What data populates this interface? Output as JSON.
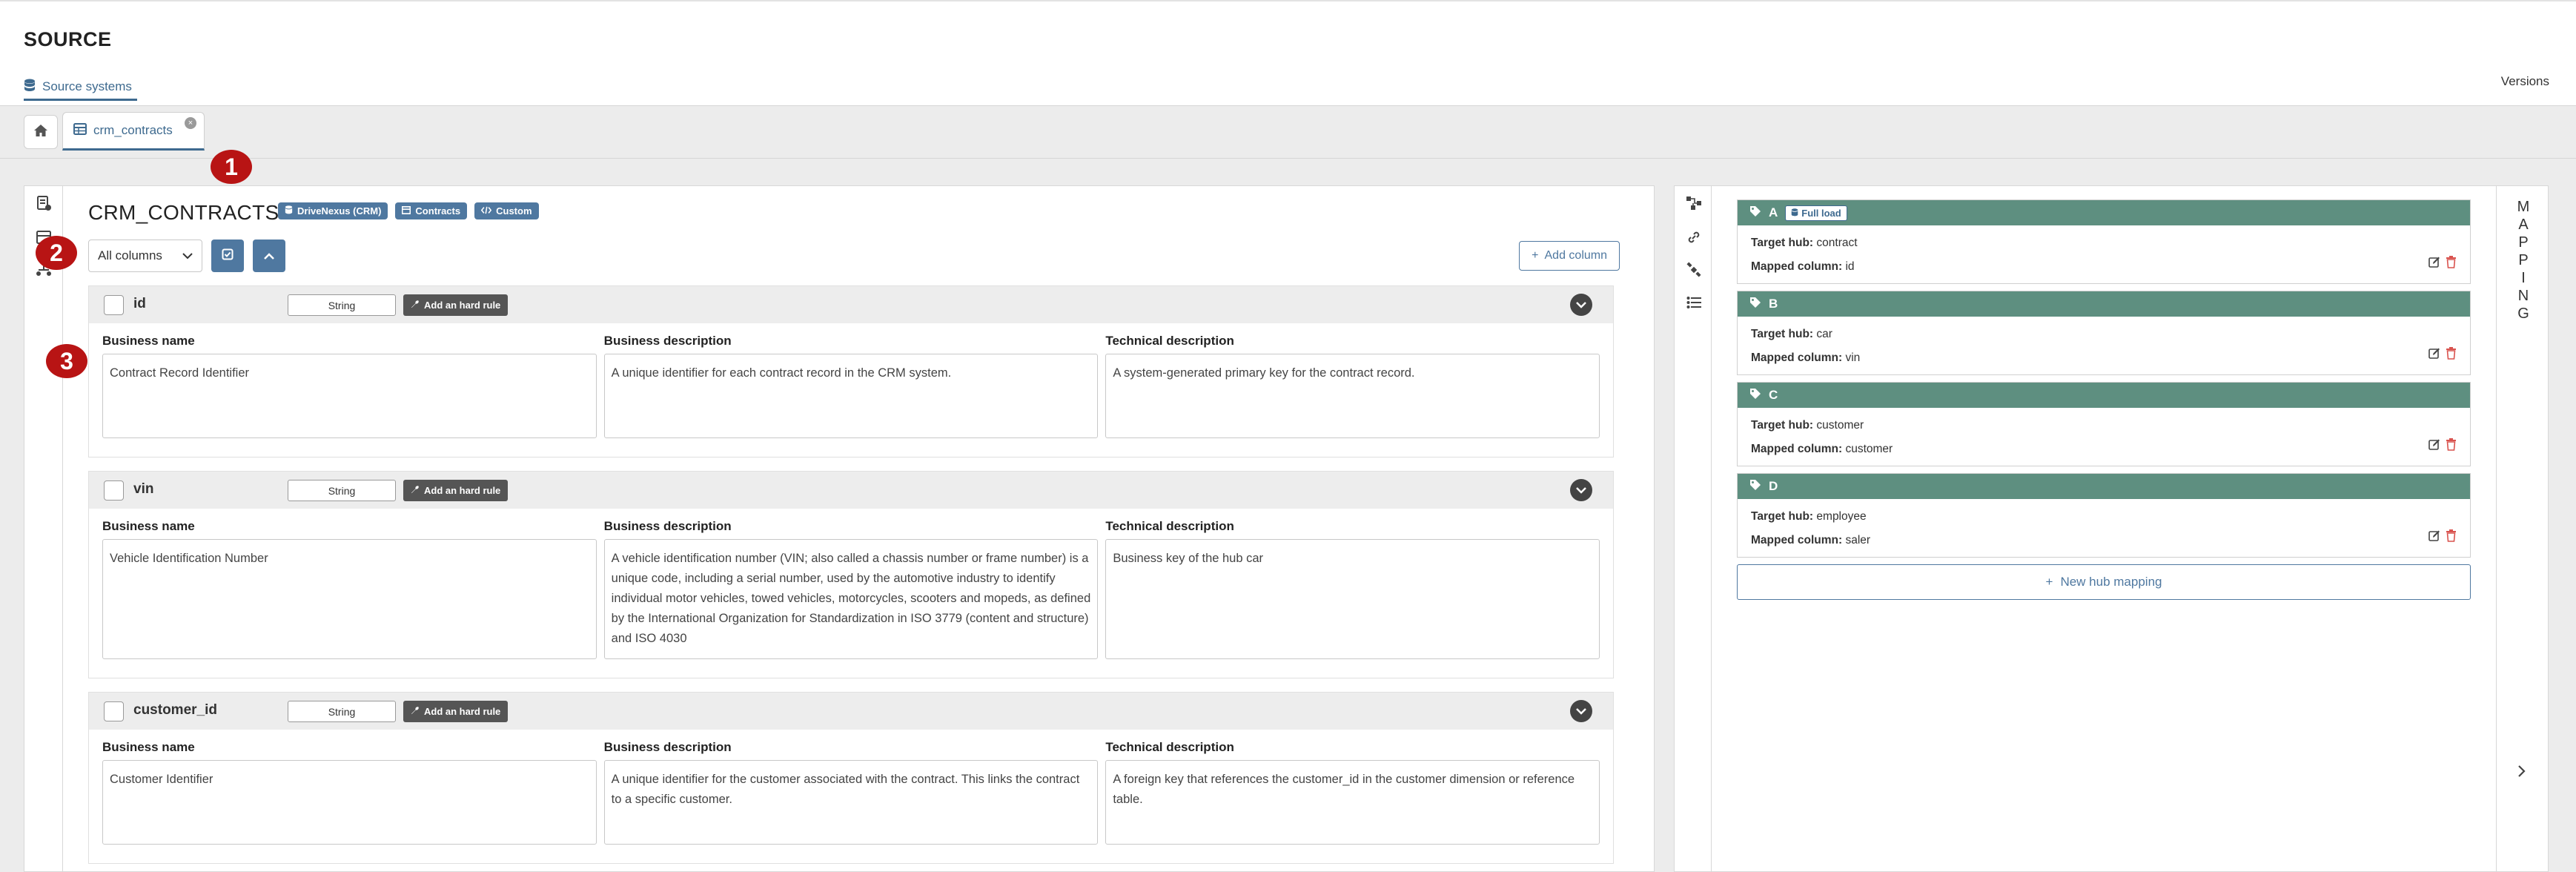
{
  "header": {
    "title": "SOURCE"
  },
  "nav": {
    "source_systems": "Source systems",
    "versions": "Versions"
  },
  "tabs": {
    "open_tab": "crm_contracts",
    "close_symbol": "×"
  },
  "markers": [
    "1",
    "2",
    "3"
  ],
  "table": {
    "title": "CRM_CONTRACTS",
    "badges": [
      "DriveNexus (CRM)",
      "Contracts",
      "Custom"
    ],
    "filter_value": "All columns",
    "add_column": "Add column"
  },
  "labels": {
    "business_name": "Business name",
    "business_description": "Business description",
    "technical_description": "Technical description",
    "add_rule": "Add an hard rule"
  },
  "columns": [
    {
      "name": "id",
      "type": "String",
      "business_name": "Contract Record Identifier",
      "business_description": "A unique identifier for each contract record in the CRM system.",
      "technical_description": "A system-generated primary key for the contract record."
    },
    {
      "name": "vin",
      "type": "String",
      "business_name": "Vehicle Identification Number",
      "business_description": "A vehicle identification number (VIN; also called a chassis number or frame number) is a unique code, including a serial number, used by the automotive industry to identify individual motor vehicles, towed vehicles, motorcycles, scooters and mopeds, as defined by the International Organization for Standardization in ISO 3779 (content and structure) and ISO 4030",
      "technical_description": "Business key of the hub car"
    },
    {
      "name": "customer_id",
      "type": "String",
      "business_name": "Customer Identifier",
      "business_description": "A unique identifier for the customer associated with the contract. This links the contract to a specific customer.",
      "technical_description": "A foreign key that references the customer_id in the customer dimension or reference table."
    }
  ],
  "mapping": {
    "target_hub_label": "Target hub:",
    "mapped_column_label": "Mapped column:",
    "full_load": "Full load",
    "items": [
      {
        "letter": "A",
        "target_hub": "contract",
        "mapped_column": "id"
      },
      {
        "letter": "B",
        "target_hub": "car",
        "mapped_column": "vin"
      },
      {
        "letter": "C",
        "target_hub": "customer",
        "mapped_column": "customer"
      },
      {
        "letter": "D",
        "target_hub": "employee",
        "mapped_column": "saler"
      }
    ],
    "new_hub_mapping": "New hub mapping",
    "vertical_label": [
      "M",
      "A",
      "P",
      "P",
      "I",
      "N",
      "G"
    ]
  },
  "icons": {
    "home": "home-icon",
    "table": "table-icon",
    "database": "database-icon",
    "tag": "tag-icon",
    "edit": "edit-icon",
    "delete": "trash-icon",
    "chevron_right": "chevron-right-icon"
  },
  "colors": {
    "accent": "#4f78a0",
    "hub_header": "#5e8f80",
    "marker": "#b81414",
    "delete": "#d9534f"
  }
}
